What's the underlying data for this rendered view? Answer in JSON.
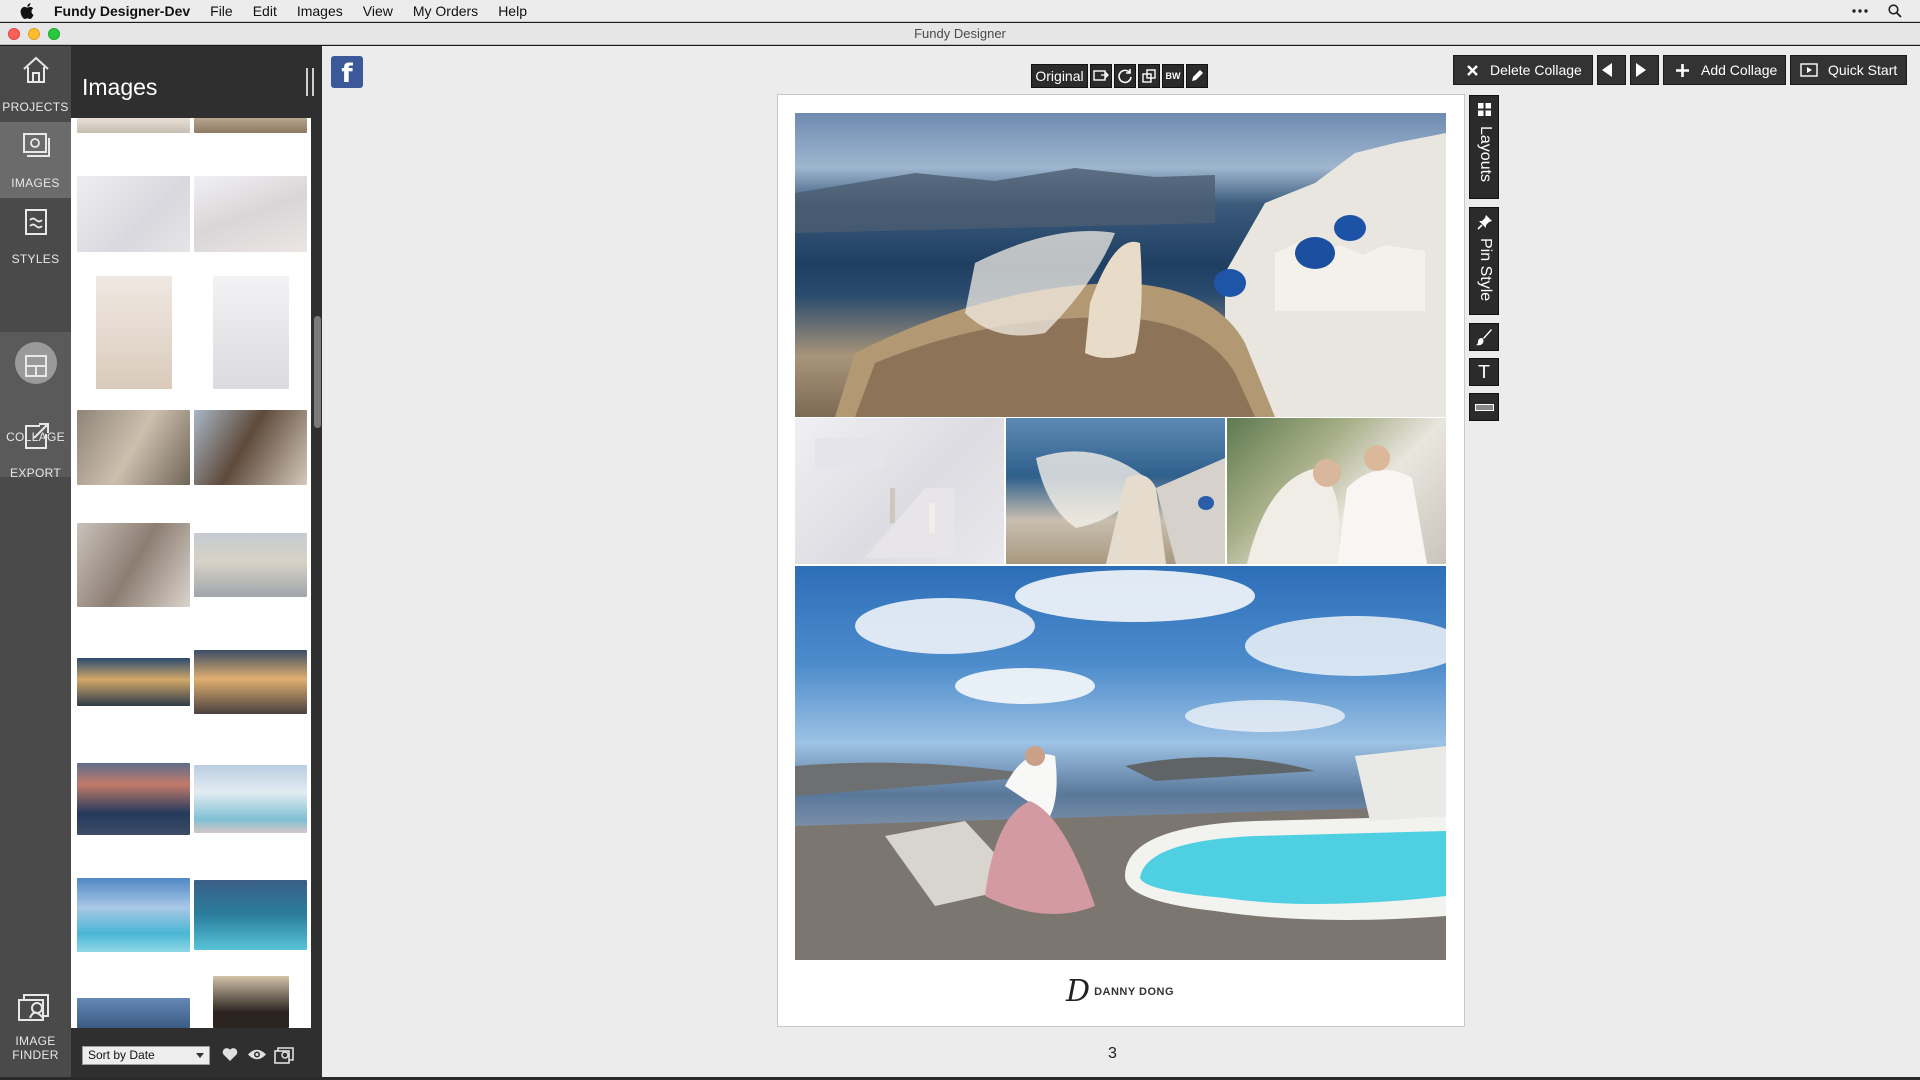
{
  "menubar": {
    "app_name": "Fundy Designer-Dev",
    "items": [
      "File",
      "Edit",
      "Images",
      "View",
      "My Orders",
      "Help"
    ]
  },
  "window": {
    "title": "Fundy Designer"
  },
  "nav": {
    "projects": "PROJECTS",
    "images": "IMAGES",
    "styles": "STYLES",
    "collage": "COLLAGE",
    "export": "EXPORT",
    "image_finder_line1": "IMAGE",
    "image_finder_line2": "FINDER"
  },
  "images_panel": {
    "title": "Images",
    "sort_value": "Sort by Date"
  },
  "image_toolbar": {
    "original_label": "Original",
    "icons": [
      "crop-icon",
      "rotate-icon",
      "duplicate-icon",
      "bw-icon",
      "edit-pencil-icon"
    ],
    "bw_label": "BW"
  },
  "actions": {
    "delete_collage": "Delete Collage",
    "add_collage": "Add Collage",
    "quick_start": "Quick Start"
  },
  "side_tools": {
    "layouts": "Layouts",
    "pin_style": "Pin Style",
    "text_icon_glyph": "T"
  },
  "page": {
    "logo_text": "DANNY DONG",
    "page_number": "3"
  },
  "colors": {
    "nav_bg": "#4a4a4a",
    "panel_bg": "#2f2f2f",
    "workspace_bg": "#ececec",
    "button_bg": "#333333",
    "facebook_blue": "#3b5998"
  }
}
